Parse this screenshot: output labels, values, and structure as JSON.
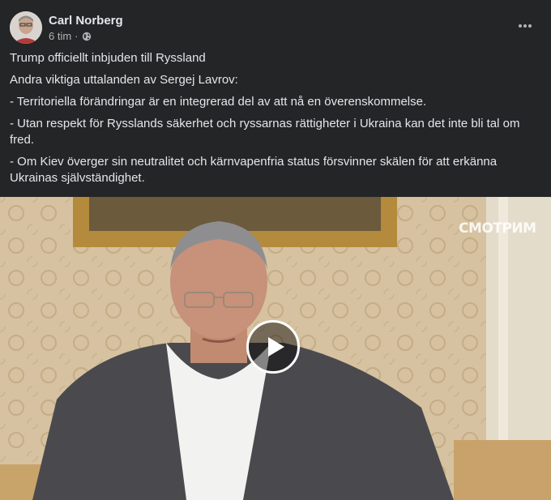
{
  "post": {
    "author": "Carl Norberg",
    "time": "6 tim",
    "separator": "·",
    "privacy_icon": "globe-icon",
    "more_icon": "more-options-icon",
    "paragraphs": [
      "Trump officiellt inbjuden till Ryssland",
      "Andra viktiga uttalanden av Sergej Lavrov:",
      "- Territoriella förändringar är en integrerad del av att nå en överenskommelse.",
      "- Utan respekt för Rysslands säkerhet och ryssarnas rättigheter i Ukraina kan det inte bli tal om fred.",
      "- Om Kiev överger sin neutralitet och kärnvapenfria status försvinner skälen för att erkänna Ukrainas självständighet."
    ]
  },
  "video": {
    "watermark": "СМОТРИМ",
    "play_icon": "play-icon"
  },
  "colors": {
    "background": "#242526",
    "primary_text": "#e4e6eb",
    "secondary_text": "#b0b3b8"
  }
}
